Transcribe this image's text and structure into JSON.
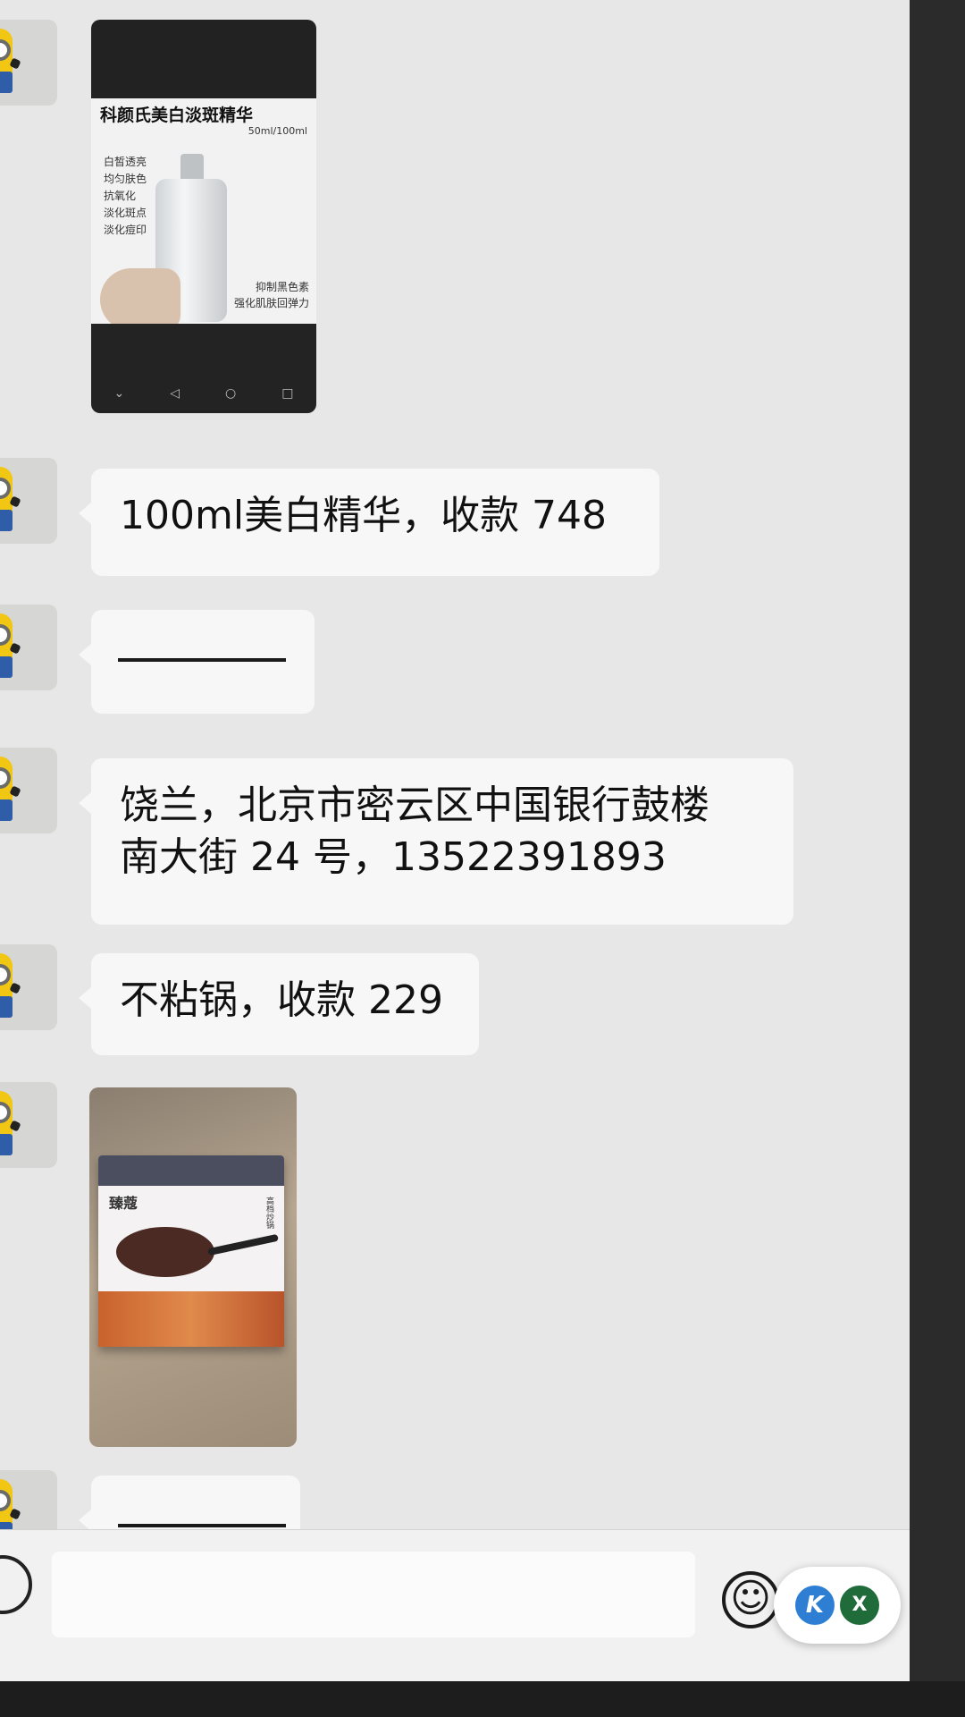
{
  "messages": [
    {
      "type": "image",
      "image": {
        "title": "科颜氏美白淡斑精华",
        "capacity": "50ml/100ml",
        "benefits": [
          "白皙透亮",
          "均匀肤色",
          "抗氧化",
          "淡化斑点",
          "淡化痘印"
        ],
        "side_text": [
          "抑制黑色素",
          "强化肌肤回弹力"
        ]
      }
    },
    {
      "type": "text",
      "text": "100ml美白精华，收款 748"
    },
    {
      "type": "text",
      "text": "————"
    },
    {
      "type": "text",
      "text_line1": "饶兰，北京市密云区中国银行鼓楼",
      "text_line2": "南大街 24 号，13522391893"
    },
    {
      "type": "text",
      "text": "不粘锅，收款 229"
    },
    {
      "type": "image",
      "image": {
        "brand": "臻蔻",
        "label": "高档炒锅"
      }
    },
    {
      "type": "text",
      "text": "————"
    }
  ],
  "icons": {
    "voice": "voice-icon",
    "emoji": "emoji-icon",
    "floating_k": "k-app-icon",
    "floating_x": "x-app-icon"
  },
  "floating_widget": {
    "k_label": "K",
    "x_label": "X"
  },
  "colors": {
    "chat_background": "#e6e7e6",
    "bubble": "#f7f7f7",
    "input_bar": "#f1f1f1",
    "k_blue": "#2e7fd4",
    "x_green": "#1f6b3a"
  }
}
